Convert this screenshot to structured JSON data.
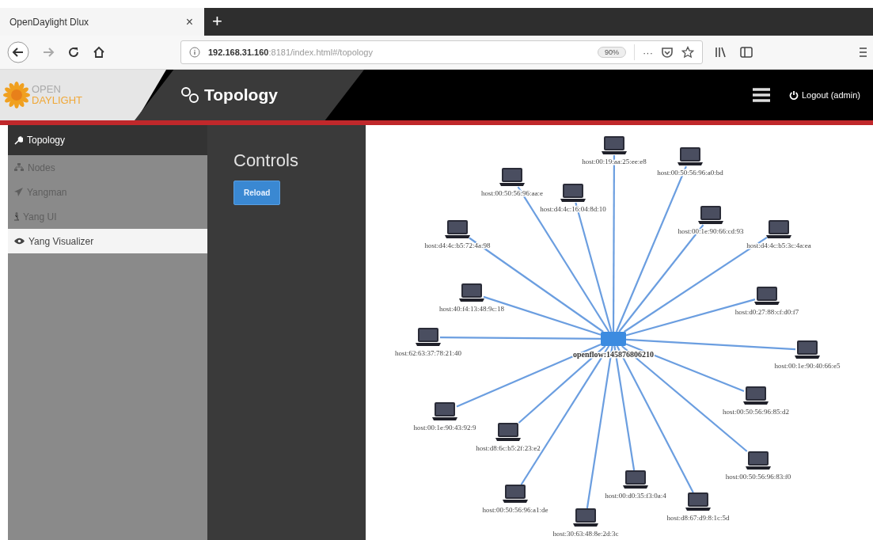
{
  "browser": {
    "tab_title": "OpenDaylight Dlux",
    "tab_close": "×",
    "new_tab": "+",
    "url": "**192.168.31.160**:8181/index.html#/topology",
    "zoom": "90%",
    "page_actions": "···"
  },
  "app_header": {
    "logo_top": "OPEN",
    "logo_bottom": "DAYLIGHT",
    "title": "Topology",
    "logout": "Logout (admin)"
  },
  "sidebar": {
    "items": [
      {
        "label": "Topology",
        "kind": "section",
        "selected": false
      },
      {
        "label": "Nodes",
        "kind": "link",
        "selected": false
      },
      {
        "label": "Yangman",
        "kind": "link",
        "selected": false
      },
      {
        "label": "Yang UI",
        "kind": "link",
        "selected": false
      },
      {
        "label": "Yang Visualizer",
        "kind": "link",
        "selected": true
      }
    ]
  },
  "controls": {
    "title": "Controls",
    "reload_button": "Reload"
  },
  "topology": {
    "switch": {
      "label": "openflow:145876806210"
    },
    "hosts": [
      {
        "label": "host:00:19:aa:25:ee:e8"
      },
      {
        "label": "host:00:50:56:96:a0:bd"
      },
      {
        "label": "host:00:50:56:96:aa:e"
      },
      {
        "label": "host:d4:4c:16:04:8d:10"
      },
      {
        "label": "host:d4:4c:b5:72:4a:98"
      },
      {
        "label": "host:00:1e:90:66:cd:93"
      },
      {
        "label": "host:d4:4c:b5:3c:4a:ea"
      },
      {
        "label": "host:40:f4:13:48:9c:18"
      },
      {
        "label": "host:d0:27:88:cf:d0:f7"
      },
      {
        "label": "host:62:63:37:78:21:40"
      },
      {
        "label": "host:00:1e:90:40:66:e5"
      },
      {
        "label": "host:00:50:56:96:85:d2"
      },
      {
        "label": "host:00:1e:90:43:92:9"
      },
      {
        "label": "host:d8:6c:b5:2f:23:e2"
      },
      {
        "label": "host:00:50:56:96:83:f0"
      },
      {
        "label": "host:00:50:56:96:a1:de"
      },
      {
        "label": "host:00:d0:35:f3:0a:4"
      },
      {
        "label": "host:d8:67:d9:8:1c:5d"
      },
      {
        "label": "host:30:63:48:8e:2d:3c"
      }
    ]
  }
}
